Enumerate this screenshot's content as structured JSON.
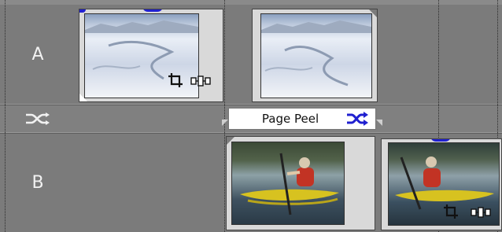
{
  "tracks": [
    {
      "id": "A",
      "label": "A"
    },
    {
      "id": "B",
      "label": "B"
    }
  ],
  "transition_track": {
    "icon": "shuffle-icon",
    "transition": {
      "label": "Page Peel",
      "icon": "transition-shuffle-icon"
    }
  },
  "clips": {
    "a1": {
      "icons": [
        "crop-icon",
        "pan-icon"
      ]
    },
    "a2": {
      "icons": []
    },
    "b1": {
      "icons": []
    },
    "b2": {
      "icons": [
        "crop-icon",
        "pan-icon"
      ]
    }
  },
  "colors": {
    "background": "#7b7b7b",
    "accent_blue": "#2020d0",
    "label_bg": "#ffffff"
  }
}
